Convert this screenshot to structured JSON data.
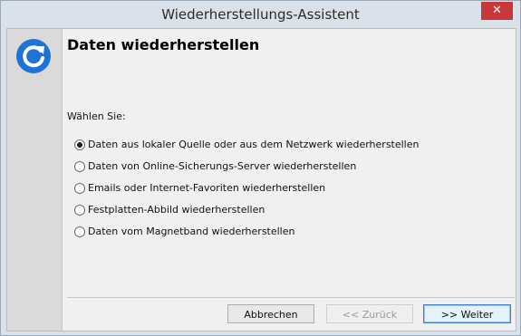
{
  "window": {
    "title": "Wiederherstellungs-Assistent",
    "close_glyph": "✕"
  },
  "page": {
    "heading": "Daten wiederherstellen",
    "prompt": "Wählen Sie:"
  },
  "options": [
    {
      "label": "Daten aus lokaler Quelle oder aus dem Netzwerk wiederherstellen",
      "selected": true
    },
    {
      "label": "Daten von Online-Sicherungs-Server wiederherstellen",
      "selected": false
    },
    {
      "label": "Emails oder Internet-Favoriten wiederherstellen",
      "selected": false
    },
    {
      "label": "Festplatten-Abbild wiederherstellen",
      "selected": false
    },
    {
      "label": "Daten vom Magnetband wiederherstellen",
      "selected": false
    }
  ],
  "buttons": {
    "cancel": "Abbrechen",
    "back": "<< Zurück",
    "next": ">> Weiter"
  },
  "colors": {
    "accent": "#1f73d6",
    "close": "#c8383b"
  },
  "icons": {
    "logo": "refresh-icon",
    "close": "close-icon"
  }
}
